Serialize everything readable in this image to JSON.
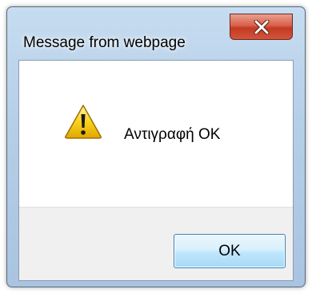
{
  "dialog": {
    "title": "Message from webpage",
    "message": "Αντιγραφή OK",
    "message_icon": "warning-icon",
    "close_icon": "close-icon",
    "ok_label": "OK"
  },
  "colors": {
    "close_button": "#c23a22",
    "ok_button_border": "#3c7fb1",
    "warning_yellow": "#f5c400",
    "frame": "#b6cfe8"
  }
}
